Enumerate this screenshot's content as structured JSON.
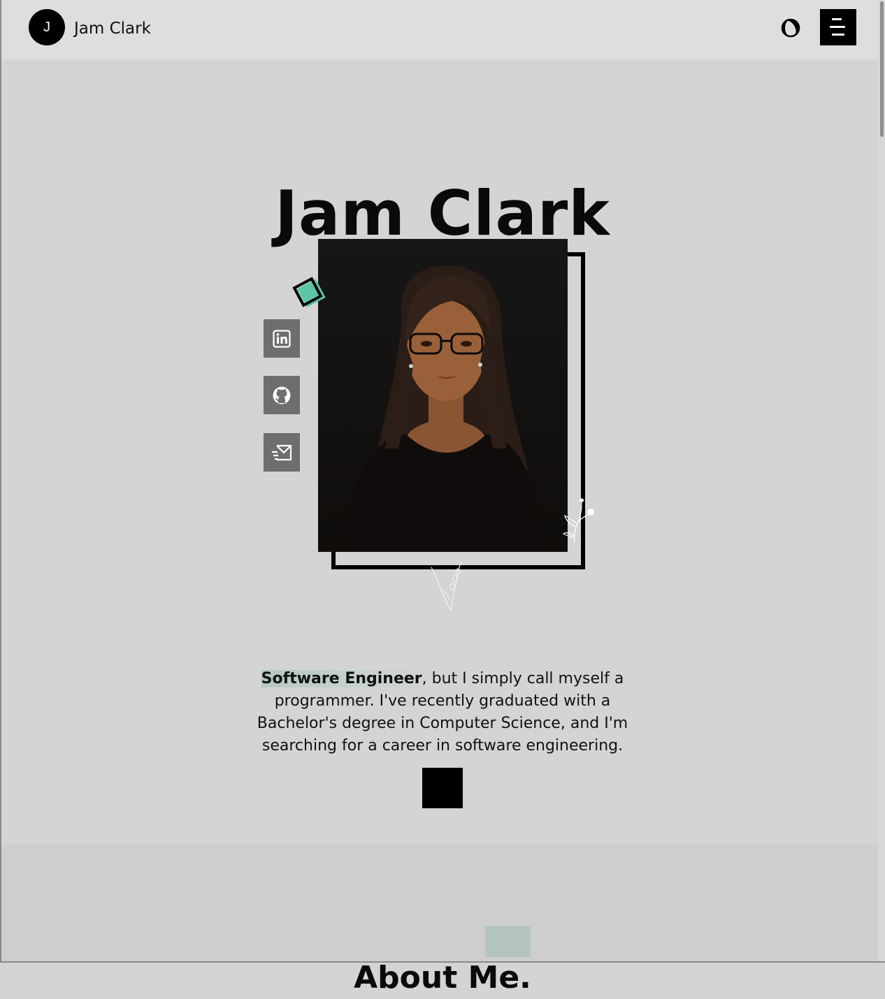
{
  "brand": {
    "initial": "J",
    "name": "Jam Clark"
  },
  "nav": {
    "theme_toggle_icon": "half-moon-icon",
    "menu_icon": "hamburger-menu-icon"
  },
  "hero": {
    "title": "Jam Clark",
    "portrait_alt": "Illustrated portrait of a woman with glasses",
    "social_links": [
      {
        "name": "linkedin",
        "icon": "linkedin-icon"
      },
      {
        "name": "github",
        "icon": "github-icon"
      },
      {
        "name": "email",
        "icon": "mail-icon"
      }
    ]
  },
  "intro": {
    "role": "Software Engineer",
    "text": ", but I simply call myself a programmer. I've recently graduated with a Bachelor's degree in Computer Science, and I'm searching for a career in software engineering."
  },
  "about": {
    "title": "About Me."
  },
  "colors": {
    "accent": "#5cc5a8",
    "highlight": "#b4c4c1",
    "background": "#d4d4d4",
    "navbar": "#dedede"
  }
}
